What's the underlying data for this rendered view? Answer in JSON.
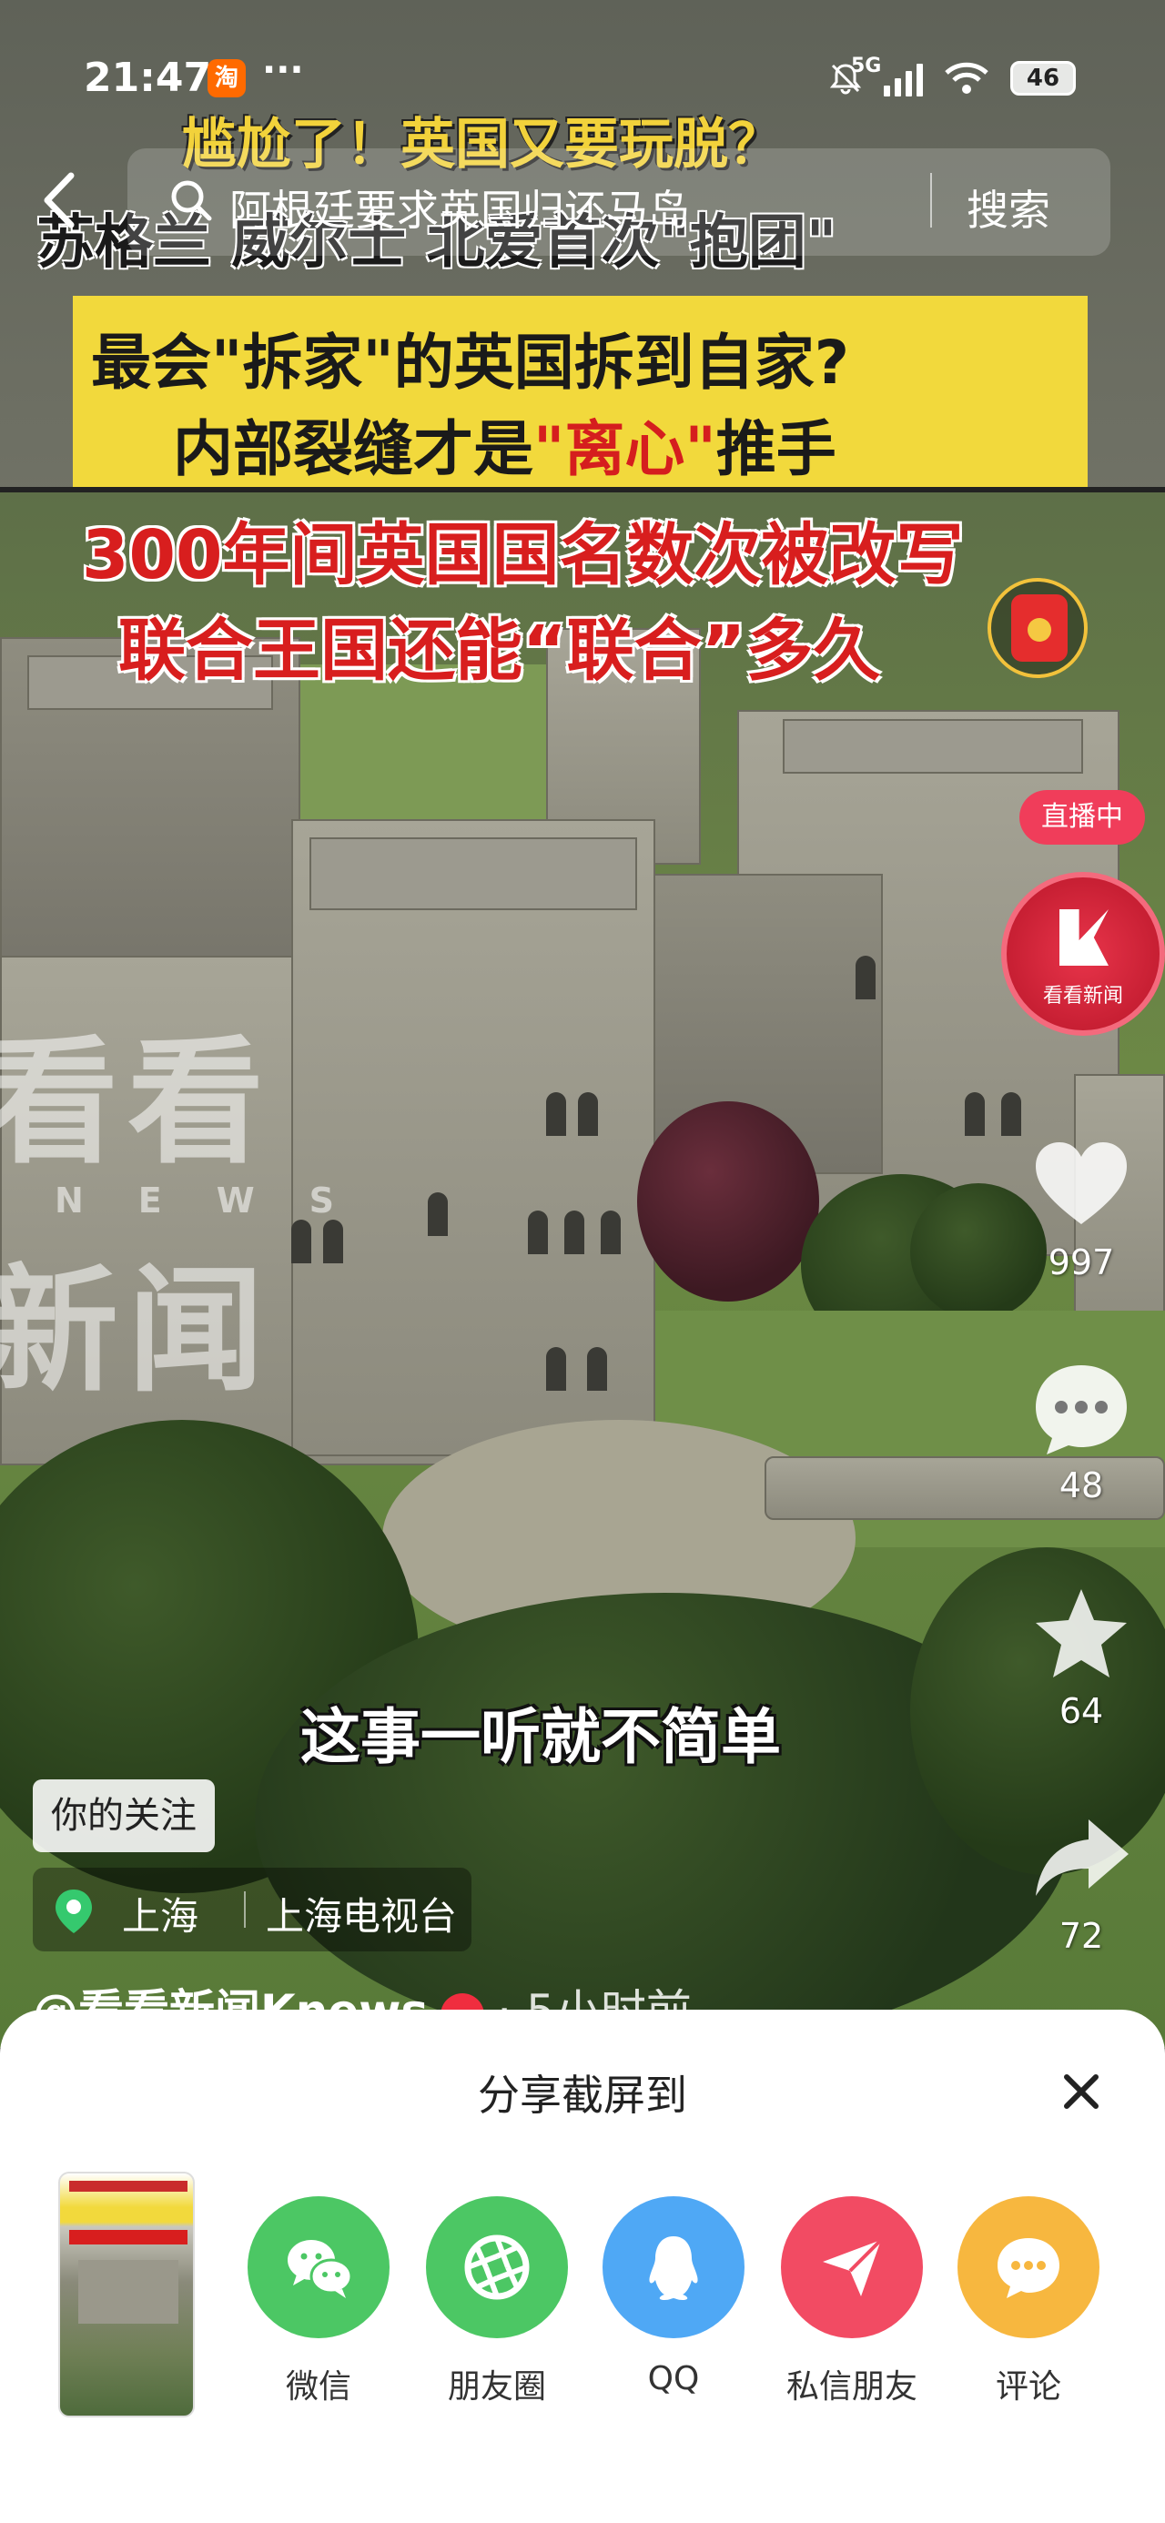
{
  "status_bar": {
    "time": "21:47",
    "app_badge": "淘",
    "more": "···",
    "network": "5G",
    "battery": "46"
  },
  "search": {
    "query": "阿根廷要求英国归还马岛",
    "button": "搜索"
  },
  "video": {
    "captions": {
      "line1": "尴尬了！英国又要玩脱？",
      "line2": "苏格兰 威尔士 北爱首次\"抱团\"",
      "line3": "最会\"拆家\"的英国拆到自家?",
      "line4a": "内部裂缝才是",
      "line4b": "\"离心\"",
      "line4c": "推手",
      "line5": "300年间英国国名数次被改写",
      "line6": "联合王国还能“联合”多久"
    },
    "subtitle": "这事一听就不简单",
    "watermark": {
      "top": "看看",
      "middle": "NEWS",
      "bottom": "新闻"
    }
  },
  "rail": {
    "live_badge": "直播中",
    "live_name": "看看新闻",
    "likes": "997",
    "comments": "48",
    "favorites": "64",
    "shares": "72"
  },
  "info": {
    "follow_tag": "你的关注",
    "location_city": "上海",
    "location_place": "上海电视台",
    "author": "@看看新闻Knews",
    "posted": "· 5小时前"
  },
  "share_sheet": {
    "title": "分享截屏到",
    "targets": [
      "微信",
      "朋友圈",
      "QQ",
      "私信朋友",
      "评论"
    ]
  },
  "colors": {
    "accent_red": "#f03d5a",
    "wechat_green": "#4cc764",
    "qq_blue": "#4fa8f5",
    "comment_orange": "#f7b73f"
  },
  "icons": [
    "back-icon",
    "search-icon",
    "mute-bell-icon",
    "signal-icon",
    "wifi-icon",
    "battery-icon",
    "red-packet-icon",
    "heart-icon",
    "comment-icon",
    "star-icon",
    "share-arrow-icon",
    "location-pin-icon",
    "close-icon",
    "wechat-icon",
    "moments-icon",
    "qq-icon",
    "send-icon",
    "chat-bubble-icon"
  ]
}
